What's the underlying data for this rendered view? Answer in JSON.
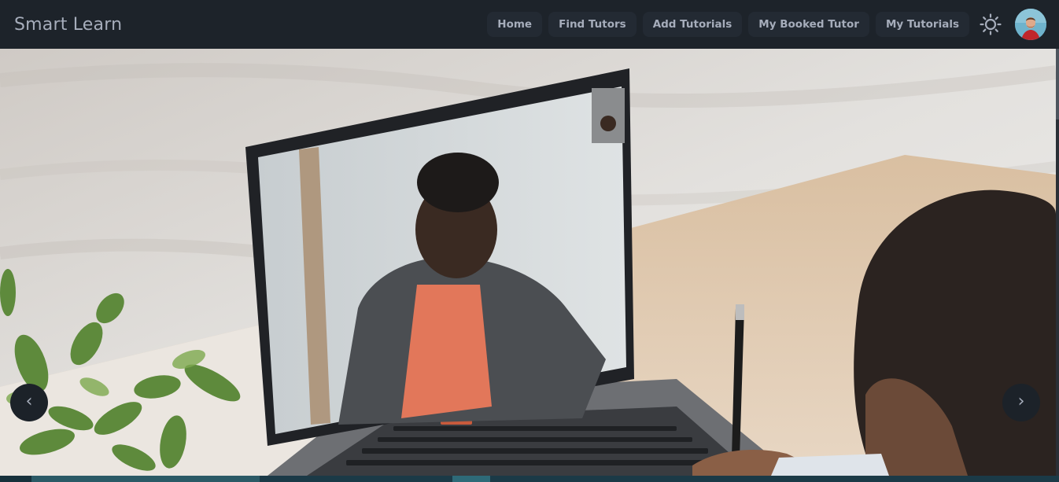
{
  "navbar": {
    "brand": "Smart Learn",
    "links": [
      {
        "label": "Home"
      },
      {
        "label": "Find Tutors"
      },
      {
        "label": "Add Tutorials"
      },
      {
        "label": "My Booked Tutor"
      },
      {
        "label": "My Tutorials"
      }
    ],
    "theme_icon": "sun-icon",
    "avatar_icon": "user-avatar"
  },
  "carousel": {
    "prev_label": "‹",
    "next_label": "›",
    "slide_icon": "online-tutoring-photo"
  },
  "colors": {
    "nav_background": "#1d232a",
    "nav_text": "#a6adbb",
    "button_background": "#232a33"
  }
}
